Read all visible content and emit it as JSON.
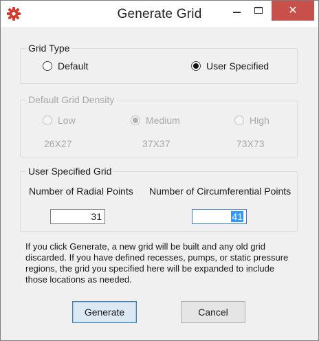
{
  "window": {
    "title": "Generate Grid",
    "close_glyph": "✕"
  },
  "grid_type": {
    "title": "Grid Type",
    "options": [
      {
        "label": "Default",
        "selected": false
      },
      {
        "label": "User Specified",
        "selected": true
      }
    ]
  },
  "default_density": {
    "title": "Default Grid Density",
    "options": [
      {
        "label": "Low",
        "size": "26X27",
        "selected": false
      },
      {
        "label": "Medium",
        "size": "37X37",
        "selected": true
      },
      {
        "label": "High",
        "size": "73X73",
        "selected": false
      }
    ]
  },
  "user_grid": {
    "title": "User Specified Grid",
    "radial_label": "Number of Radial Points",
    "radial_value": "31",
    "circ_label": "Number of Circumferential Points",
    "circ_value": "41"
  },
  "note": "If you click Generate, a new grid will be built and any old grid discarded. If you have defined recesses, pumps, or static pressure regions, the grid you specified here will be expanded to include those locations as needed.",
  "buttons": {
    "generate": "Generate",
    "cancel": "Cancel"
  },
  "colors": {
    "close_button": "#c7504a",
    "app_icon": "#d23a2e",
    "selection": "#3399ff"
  },
  "icons": {
    "app": "red-gear-icon"
  }
}
